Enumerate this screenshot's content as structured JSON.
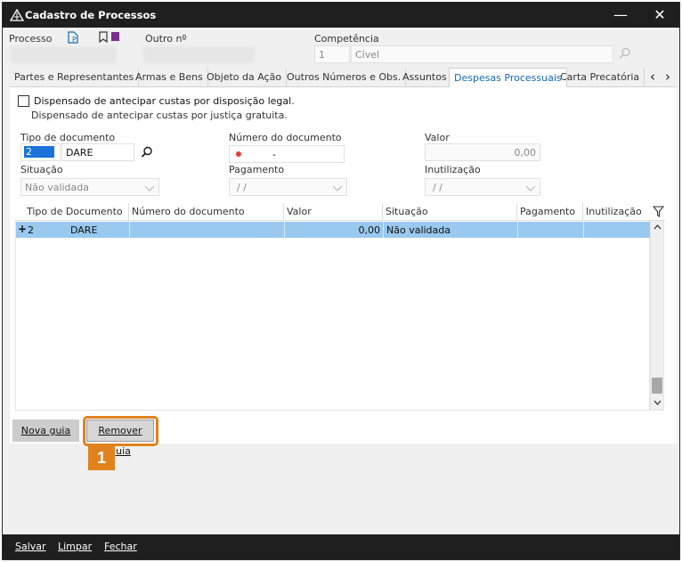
{
  "window": {
    "title": "Cadastro de Processos",
    "minimize_glyph": "—",
    "close_glyph": "✕"
  },
  "header": {
    "processo_label": "Processo",
    "outro_label": "Outro nº",
    "competencia_label": "Competência",
    "competencia_code": "1",
    "competencia_value": "Cível"
  },
  "tabs": [
    {
      "label": "Partes e Representantes"
    },
    {
      "label": "Armas e Bens"
    },
    {
      "label": "Objeto da Ação"
    },
    {
      "label": "Outros Números e Obs."
    },
    {
      "label": "Assuntos"
    },
    {
      "label": "Despesas Processuais",
      "active": true
    },
    {
      "label": "Carta Precatória"
    }
  ],
  "tab_nav": {
    "prev": "‹",
    "next": "›"
  },
  "form": {
    "dispensado_checkbox_label": "Dispensado de antecipar custas por disposição legal.",
    "dispensado_note": "Dispensado de antecipar custas por justiça gratuita.",
    "tipo_documento_label": "Tipo de documento",
    "tipo_documento_code": "2",
    "tipo_documento_value": "DARE",
    "numero_documento_label": "Número do documento",
    "numero_documento_value": "-",
    "valor_label": "Valor",
    "valor_value": "0,00",
    "situacao_label": "Situação",
    "situacao_value": "Não validada",
    "pagamento_label": "Pagamento",
    "pagamento_value": "/ /",
    "inutilizacao_label": "Inutilização",
    "inutilizacao_value": "/ /"
  },
  "grid": {
    "columns": [
      "Tipo de Documento",
      "Número do documento",
      "Valor",
      "Situação",
      "Pagamento",
      "Inutilização"
    ],
    "rows": [
      {
        "expand": "+",
        "tipo_code": "2",
        "tipo": "DARE",
        "numero": "",
        "valor": "0,00",
        "situacao": "Não validada",
        "pagamento": "",
        "inutilizacao": ""
      }
    ]
  },
  "buttons": {
    "nova_guia": "Nova guia",
    "remover_guia": "Remover guia",
    "callout_number": "1"
  },
  "footer": {
    "salvar": "Salvar",
    "limpar": "Limpar",
    "fechar": "Fechar"
  },
  "colors": {
    "titlebar": "#1f1f1f",
    "accent_tab": "#1468b8",
    "row_selected": "#99c9ef",
    "callout": "#e0821e"
  }
}
